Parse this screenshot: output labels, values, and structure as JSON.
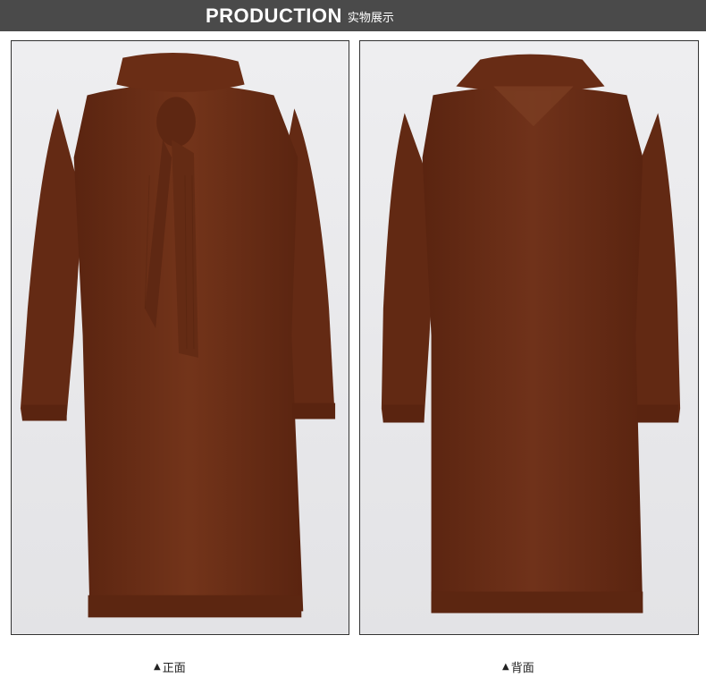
{
  "header": {
    "title": "PRODUCTION",
    "subtitle": "实物展示"
  },
  "photos": {
    "front": {
      "caption": "正面",
      "marker_icon": "triangle-up-icon"
    },
    "back": {
      "caption": "背面",
      "marker_icon": "triangle-up-icon"
    }
  },
  "colors": {
    "header_bg": "#4a4a4a",
    "sweater": "#6e2f17",
    "photo_bg": "#e9e9eb"
  }
}
